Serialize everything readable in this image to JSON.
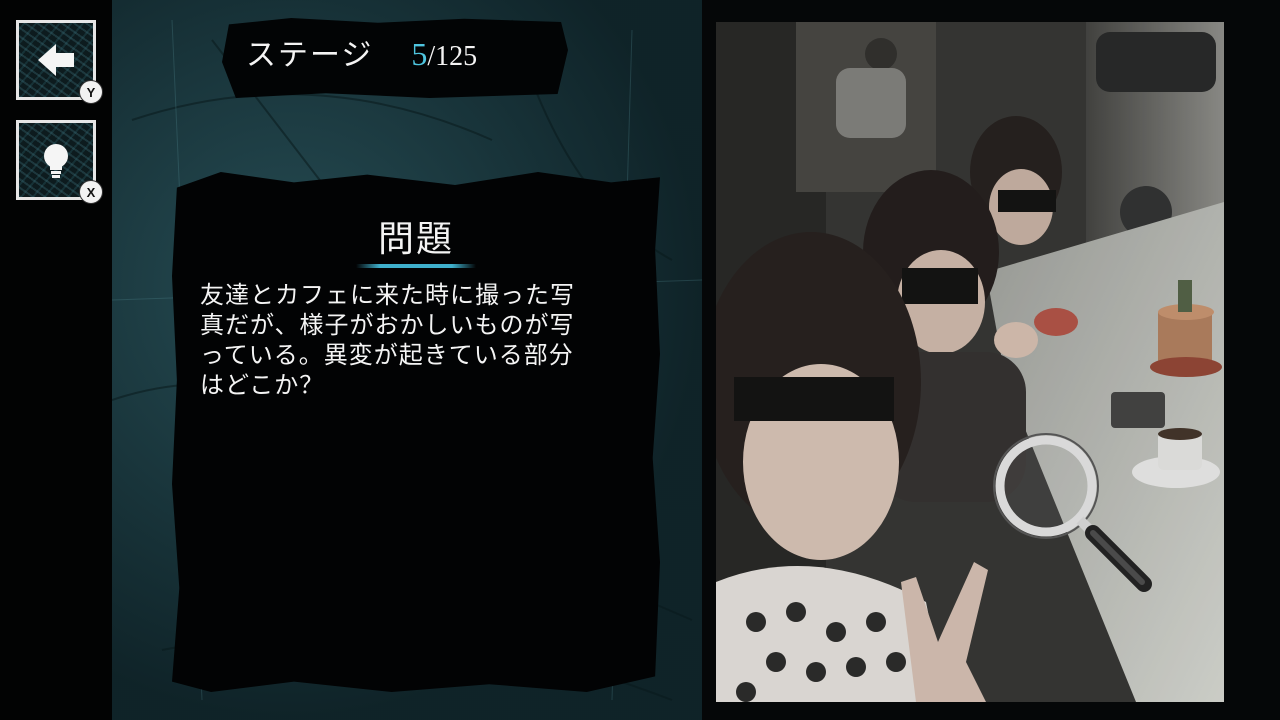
{
  "buttons": {
    "back": {
      "key": "Y",
      "icon": "back-arrow-icon"
    },
    "hint": {
      "key": "X",
      "icon": "lightbulb-icon"
    }
  },
  "stage": {
    "label": "ステージ",
    "current": "5",
    "total": "/125"
  },
  "question": {
    "title": "問題",
    "text": "友達とカフェに来た時に撮った写\n真だが、様子がおかしいものが写\nっている。異変が起きている部分\nはどこか？"
  },
  "colors": {
    "accent": "#4fc6e0",
    "panel": "#020304",
    "background": "#13292d"
  }
}
